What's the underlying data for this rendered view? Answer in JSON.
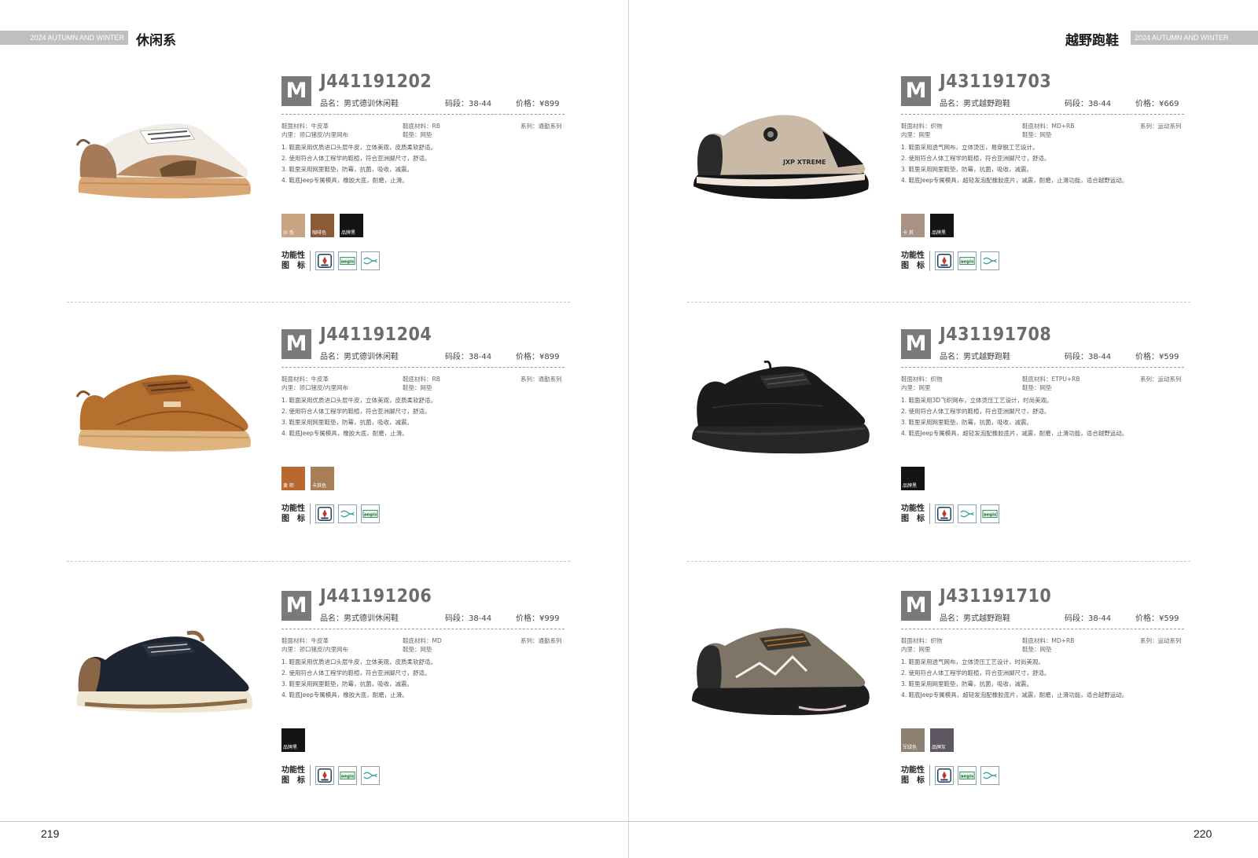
{
  "left_page": {
    "header_bar": "2024 AUTUMN AND WINTER",
    "series_title": "休闲系",
    "page_number": "219"
  },
  "right_page": {
    "header_bar": "2024 AUTUMN AND WINTER",
    "series_title": "越野跑鞋",
    "page_number": "220"
  },
  "products": [
    {
      "badge": "M",
      "code": "J441191202",
      "name": "品名：男式德训休闲鞋",
      "size": "码段：38-44",
      "price": "价格：¥899",
      "upper": "鞋面材料：牛皮革",
      "lining": "内里：领口猪皮/内里网布",
      "sole": "鞋底材料：RB",
      "insole": "鞋垫：网垫",
      "series": "系列：通勤系列",
      "features": [
        "1. 鞋面采用优质进口头层牛皮，立体美观，皮质柔软舒适。",
        "2. 使用符合人体工程学的鞋楦，符合亚洲脚尺寸，舒适。",
        "3. 鞋里采用网里鞋垫，防霉，抗菌，吸收，减震。",
        "4. 鞋底Jeep专属模具，橡胶大底，耐磨，止滑。"
      ],
      "colors": [
        {
          "label": "沙 色",
          "hex": "#c9a483"
        },
        {
          "label": "咖啡色",
          "hex": "#8b5a36"
        },
        {
          "label": "品牌黑",
          "hex": "#141414"
        }
      ],
      "func_label": "功能性图　标",
      "func_icons": [
        "quality-cert-icon",
        "aegis-icon",
        "wave-icon"
      ],
      "shoe_icon": "casual-sneaker-beige-white-icon"
    },
    {
      "badge": "M",
      "code": "J441191204",
      "name": "品名：男式德训休闲鞋",
      "size": "码段：38-44",
      "price": "价格：¥899",
      "upper": "鞋面材料：牛皮革",
      "lining": "内里：领口猪皮/内里网布",
      "sole": "鞋底材料：RB",
      "insole": "鞋垫：网垫",
      "series": "系列：通勤系列",
      "features": [
        "1. 鞋面采用优质进口头层牛皮，立体美观，皮质柔软舒适。",
        "2. 使用符合人体工程学的鞋楦，符合亚洲脚尺寸，舒适。",
        "3. 鞋里采用网里鞋垫，防霉，抗菌，吸收，减震。",
        "4. 鞋底Jeep专属模具，橡胶大底，耐磨，止滑。"
      ],
      "colors": [
        {
          "label": "黄 棕",
          "hex": "#b8692f"
        },
        {
          "label": "卡其色",
          "hex": "#a87e58"
        }
      ],
      "func_label": "功能性图　标",
      "func_icons": [
        "quality-cert-icon",
        "wave-icon",
        "aegis-icon"
      ],
      "shoe_icon": "casual-sneaker-tan-suede-icon"
    },
    {
      "badge": "M",
      "code": "J441191206",
      "name": "品名：男式德训休闲鞋",
      "size": "码段：38-44",
      "price": "价格：¥999",
      "upper": "鞋面材料：牛皮革",
      "lining": "内里：领口猪皮/内里网布",
      "sole": "鞋底材料：MD",
      "insole": "鞋垫：网垫",
      "series": "系列：通勤系列",
      "features": [
        "1. 鞋面采用优质进口头层牛皮，立体美观，皮质柔软舒适。",
        "2. 使用符合人体工程学的鞋楦，符合亚洲脚尺寸，舒适。",
        "3. 鞋里采用网里鞋垫，防霉，抗菌，吸收，减震。",
        "4. 鞋底Jeep专属模具，橡胶大底，耐磨，止滑。"
      ],
      "colors": [
        {
          "label": "品牌黑",
          "hex": "#141414"
        }
      ],
      "func_label": "功能性图　标",
      "func_icons": [
        "quality-cert-icon",
        "aegis-icon",
        "wave-icon"
      ],
      "shoe_icon": "casual-sneaker-navy-icon"
    },
    {
      "badge": "M",
      "code": "J431191703",
      "name": "品名：男式越野跑鞋",
      "size": "码段：38-44",
      "price": "价格：¥669",
      "upper": "鞋面材料：织物",
      "lining": "内里：网里",
      "sole": "鞋底材料：MD+RB",
      "insole": "鞋垫：网垫",
      "series": "系列：运动系列",
      "features": [
        "1. 鞋面采用透气网布，立体烫压，易穿脱工艺设计。",
        "2. 使用符合人体工程学的鞋楦，符合亚洲脚尺寸，舒适。",
        "3. 鞋里采用网里鞋垫，防霉，抗菌，吸收，减震。",
        "4. 鞋底Jeep专属模具，超轻发泡配橡胶底片，减震，耐磨，止滑功能，适合越野运动。"
      ],
      "colors": [
        {
          "label": "卡 其",
          "hex": "#a89284"
        },
        {
          "label": "品牌黑",
          "hex": "#141414"
        }
      ],
      "func_label": "功能性图　标",
      "func_icons": [
        "quality-cert-icon",
        "aegis-icon",
        "wave-icon"
      ],
      "shoe_icon": "trail-runner-khaki-boa-icon"
    },
    {
      "badge": "M",
      "code": "J431191708",
      "name": "品名：男式越野跑鞋",
      "size": "码段：38-44",
      "price": "价格：¥599",
      "upper": "鞋面材料：织物",
      "lining": "内里：网里",
      "sole": "鞋底材料：ETPU+RB",
      "insole": "鞋垫：网垫",
      "series": "系列：运动系列",
      "features": [
        "1. 鞋面采用3D飞织网布，立体烫压工艺设计，时尚美观。",
        "2. 使用符合人体工程学的鞋楦，符合亚洲脚尺寸，舒适。",
        "3. 鞋里采用网里鞋垫，防霉，抗菌，吸收，减震。",
        "4. 鞋底Jeep专属模具，超轻发泡配橡胶底片，减震，耐磨，止滑功能，适合越野运动。"
      ],
      "colors": [
        {
          "label": "品牌黑",
          "hex": "#141414"
        }
      ],
      "func_label": "功能性图　标",
      "func_icons": [
        "quality-cert-icon",
        "wave-icon",
        "aegis-icon"
      ],
      "shoe_icon": "trail-runner-black-knit-icon"
    },
    {
      "badge": "M",
      "code": "J431191710",
      "name": "品名：男式越野跑鞋",
      "size": "码段：38-44",
      "price": "价格：¥599",
      "upper": "鞋面材料：织物",
      "lining": "内里：网里",
      "sole": "鞋底材料：MD+RB",
      "insole": "鞋垫：网垫",
      "series": "系列：运动系列",
      "features": [
        "1. 鞋面采用透气网布，立体烫压工艺设计，时尚美观。",
        "2. 使用符合人体工程学的鞋楦，符合亚洲脚尺寸，舒适。",
        "3. 鞋里采用网里鞋垫，防霉，抗菌，吸收，减震。",
        "4. 鞋底Jeep专属模具，超轻发泡配橡胶底片，减震，耐磨，止滑功能，适合越野运动。"
      ],
      "colors": [
        {
          "label": "军绿色",
          "hex": "#8d8171"
        },
        {
          "label": "品牌灰",
          "hex": "#5e5862"
        }
      ],
      "func_label": "功能性图　标",
      "func_icons": [
        "quality-cert-icon",
        "aegis-icon",
        "wave-icon"
      ],
      "shoe_icon": "trail-runner-olive-icon"
    }
  ]
}
